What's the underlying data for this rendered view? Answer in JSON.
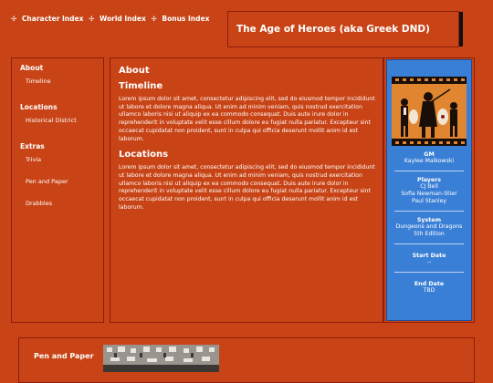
{
  "nav": {
    "items": [
      "Character Index",
      "World Index",
      "Bonus Index"
    ],
    "separator": "✢"
  },
  "header": {
    "title": "The Age of Heroes (aka Greek DND)"
  },
  "sidebar": {
    "sections": [
      {
        "heading": "About",
        "items": [
          "Timeline"
        ]
      },
      {
        "heading": "Locations",
        "items": [
          "Historical District"
        ]
      },
      {
        "heading": "Extras",
        "items": [
          "Trivia",
          "Pen and Paper",
          "Drabbles"
        ]
      }
    ]
  },
  "main": {
    "title": "About",
    "sections": [
      {
        "heading": "Timeline",
        "body": "Lorem ipsum dolor sit amet, consectetur adipiscing elit, sed do eiusmod tempor incididunt ut labore et dolore magna aliqua. Ut enim ad minim veniam, quis nostrud exercitation ullamco laboris nisi ut aliquip ex ea commodo consequat. Duis aute irure dolor in reprehenderit in voluptate velit esse cillum dolore eu fugiat nulla pariatur. Excepteur sint occaecat cupidatat non proident, sunt in culpa qui officia deserunt mollit anim id est laborum."
      },
      {
        "heading": "Locations",
        "body": "Lorem ipsum dolor sit amet, consectetur adipiscing elit, sed do eiusmod tempor incididunt ut labore et dolore magna aliqua. Ut enim ad minim veniam, quis nostrud exercitation ullamco laboris nisi ut aliquip ex ea commodo consequat. Duis aute irure dolor in reprehenderit in voluptate velit esse cillum dolore eu fugiat nulla pariatur. Excepteur sint occaecat cupidatat non proident, sunt in culpa qui officia deserunt mollit anim id est laborum."
      }
    ]
  },
  "infobox": {
    "gm_label": "GM",
    "gm": "Kaylee Malkowski",
    "players_label": "Players",
    "players": [
      "CJ Bell",
      "Sofia Newman-Stier",
      "Paul Stanley"
    ],
    "system_label": "System",
    "system": [
      "Dungeons and Dragons",
      "5th Edition"
    ],
    "start_label": "Start Date",
    "start": "--",
    "end_label": "End Date",
    "end": "TBD"
  },
  "bottom": {
    "title": "Pen and Paper"
  },
  "colors": {
    "background": "#c84416",
    "border": "#8f1c0c",
    "infobox": "#3a7fd6"
  }
}
